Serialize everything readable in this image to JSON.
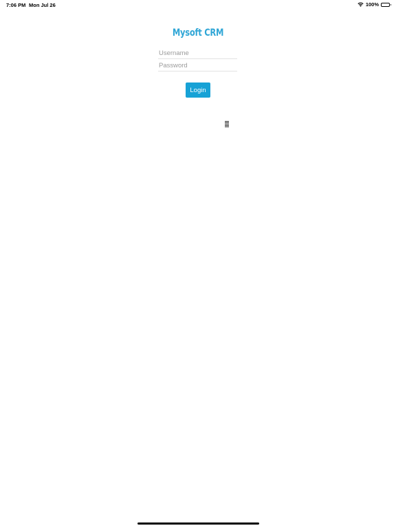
{
  "status_bar": {
    "time": "7:06 PM",
    "date": "Mon Jul 26",
    "battery_percent": "100%",
    "battery_level": 1.0,
    "icons": [
      "wifi-icon",
      "battery-icon"
    ]
  },
  "app": {
    "title": "Mysoft CRM"
  },
  "form": {
    "username": {
      "value": "",
      "placeholder": "Username"
    },
    "password": {
      "value": "",
      "placeholder": "Password"
    },
    "login_label": "Login"
  },
  "loader": {
    "icon": "loading-bars-icon"
  },
  "colors": {
    "accent": "#2fa6d6",
    "button_bg": "#17a2d6",
    "button_text": "#ffffff",
    "placeholder": "#9b9b9b",
    "divider": "#e2e2e2"
  }
}
